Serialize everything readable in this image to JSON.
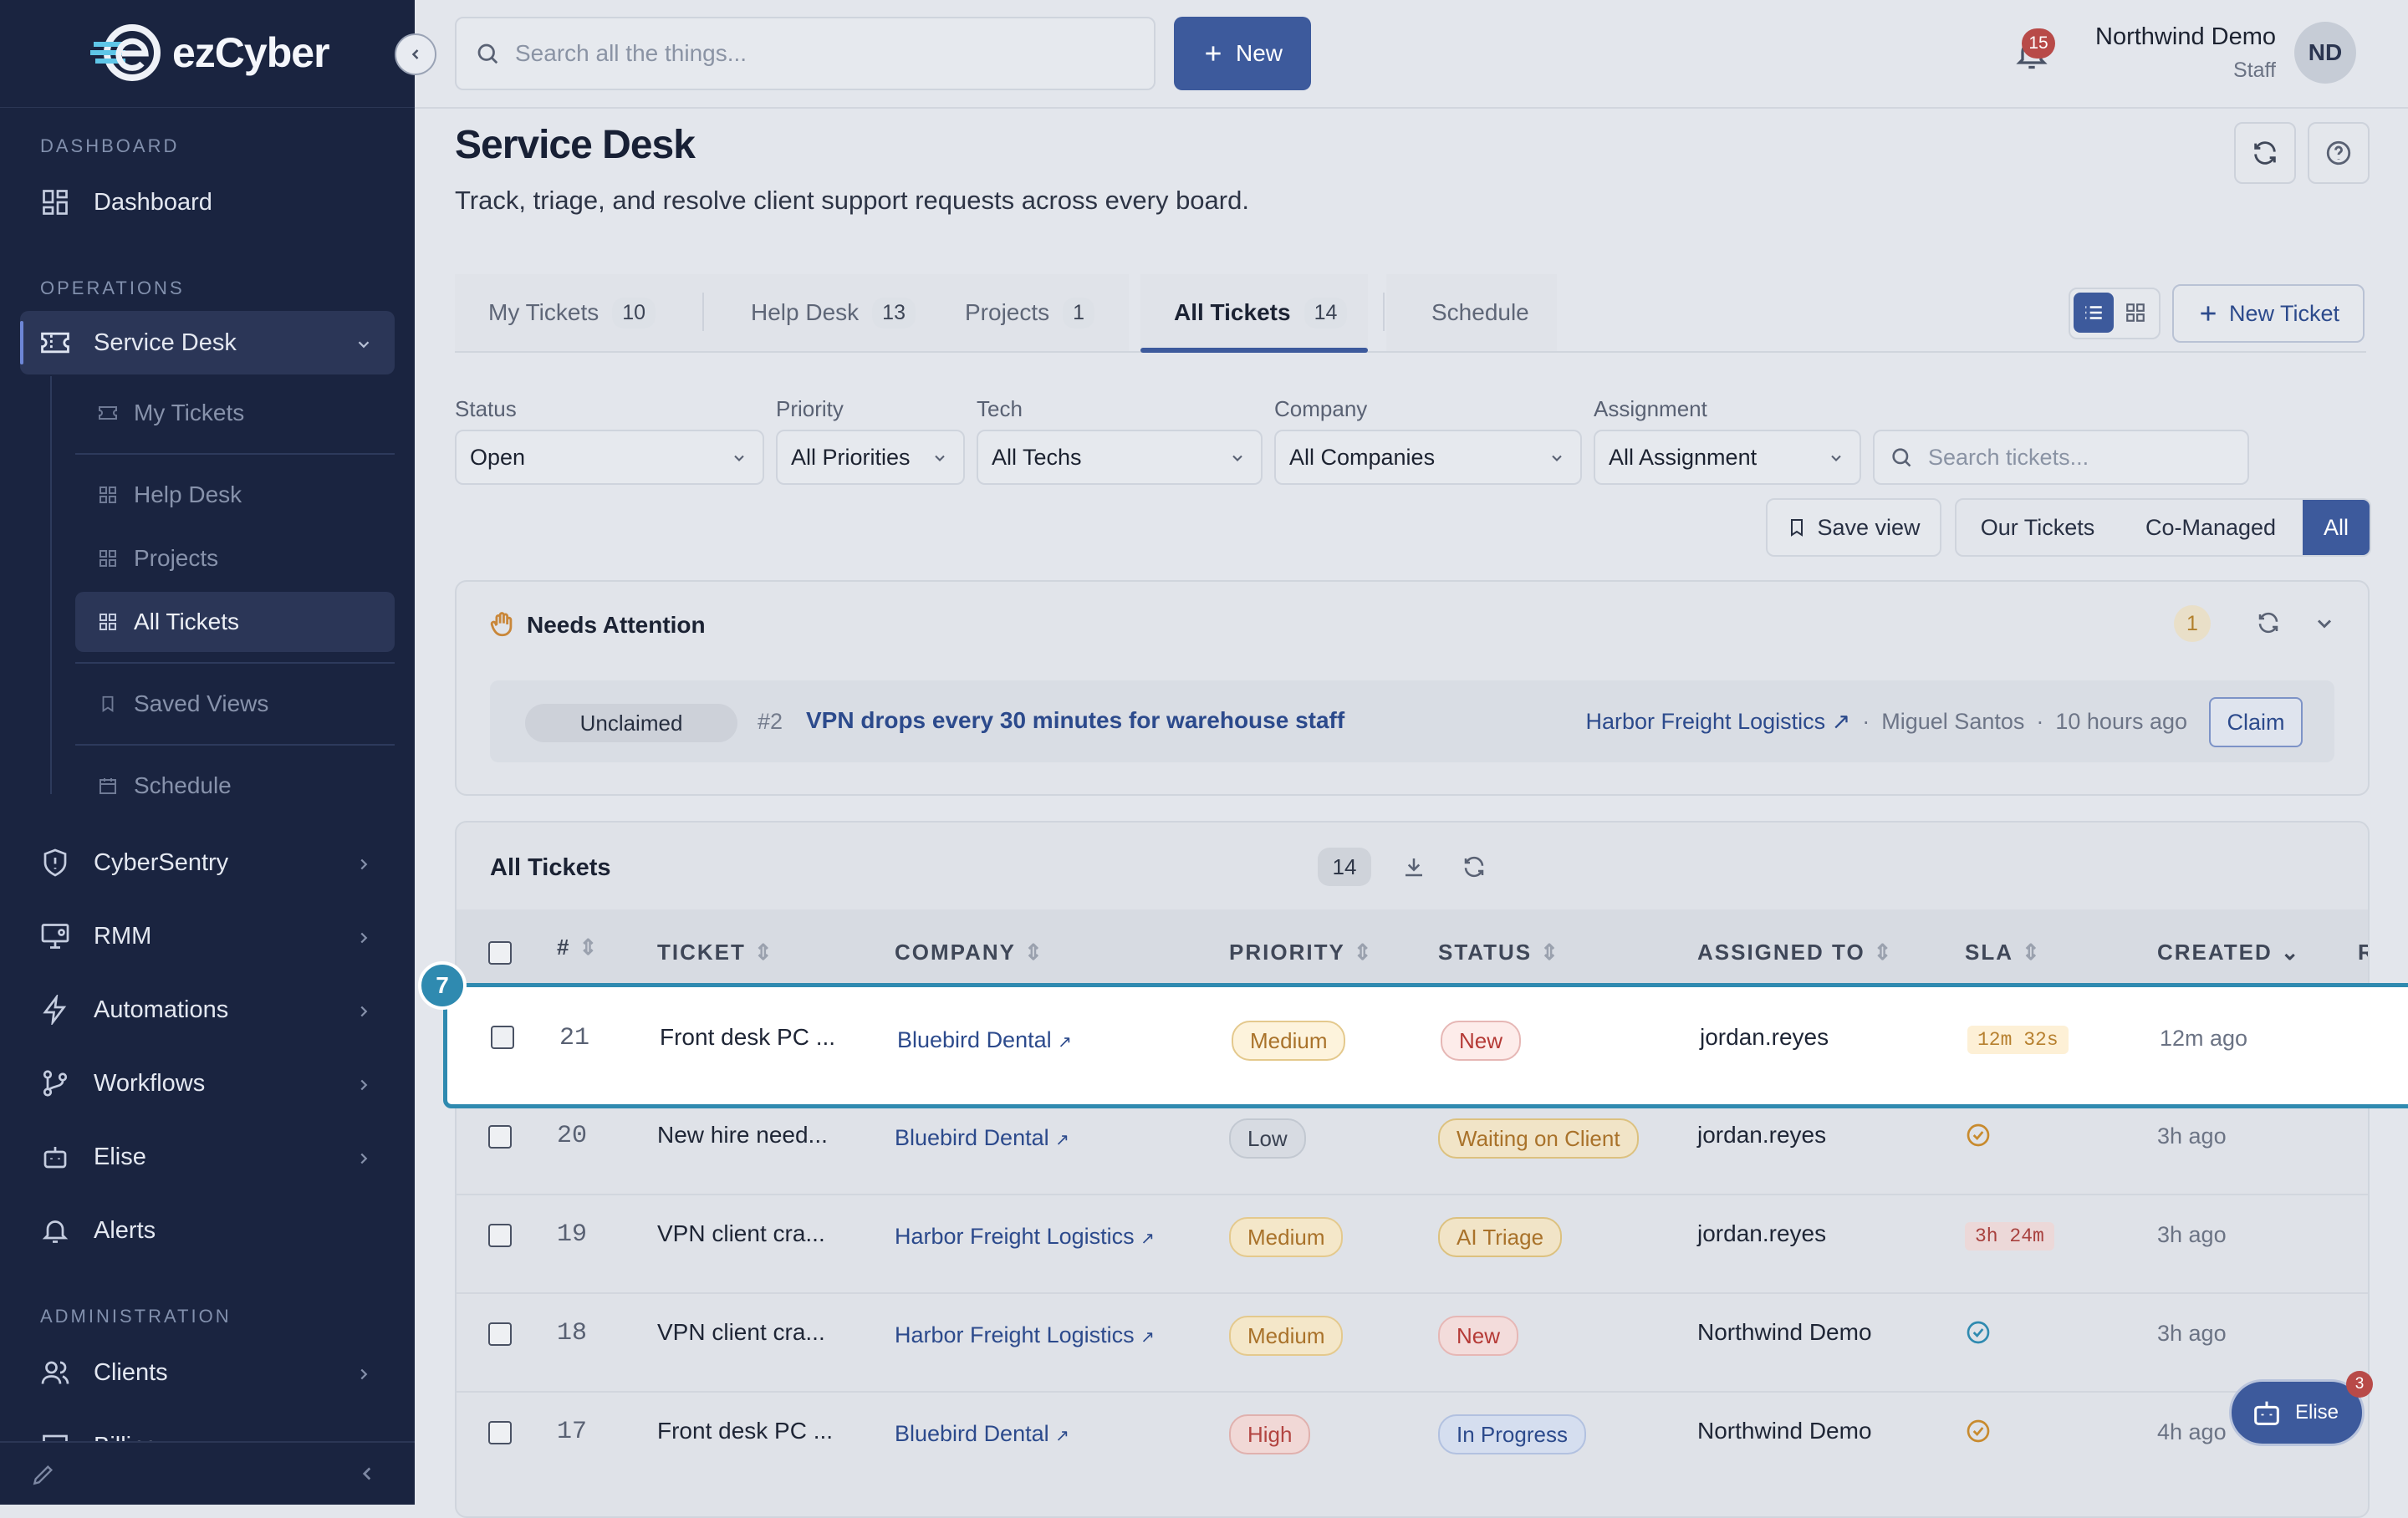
{
  "app": {
    "logo_text": "ezCyber"
  },
  "sidebar": {
    "sections": {
      "dashboard": "DASHBOARD",
      "operations": "OPERATIONS",
      "administration": "ADMINISTRATION"
    },
    "items": {
      "dashboard": "Dashboard",
      "service_desk": "Service Desk",
      "cybersentry": "CyberSentry",
      "rmm": "RMM",
      "automations": "Automations",
      "workflows": "Workflows",
      "elise": "Elise",
      "alerts": "Alerts",
      "clients": "Clients",
      "billing": "Billing"
    },
    "sub_items": {
      "my_tickets": "My Tickets",
      "help_desk": "Help Desk",
      "projects": "Projects",
      "all_tickets": "All Tickets",
      "saved_views": "Saved Views",
      "schedule": "Schedule"
    }
  },
  "topbar": {
    "search_placeholder": "Search all the things...",
    "new_label": "New",
    "notification_count": "15",
    "user_name": "Northwind Demo",
    "user_role": "Staff",
    "user_initials": "ND"
  },
  "page": {
    "title": "Service Desk",
    "subtitle": "Track, triage, and resolve client support requests across every board."
  },
  "tabs": [
    {
      "label": "My Tickets",
      "count": "10"
    },
    {
      "label": "Help Desk",
      "count": "13"
    },
    {
      "label": "Projects",
      "count": "1"
    },
    {
      "label": "All Tickets",
      "count": "14"
    },
    {
      "label": "Schedule",
      "count": ""
    }
  ],
  "new_ticket_label": "New Ticket",
  "filters": {
    "status": {
      "label": "Status",
      "value": "Open"
    },
    "priority": {
      "label": "Priority",
      "value": "All Priorities"
    },
    "tech": {
      "label": "Tech",
      "value": "All Techs"
    },
    "company": {
      "label": "Company",
      "value": "All Companies"
    },
    "assignment": {
      "label": "Assignment",
      "value": "All Assignment"
    },
    "search_placeholder": "Search tickets..."
  },
  "save_view_label": "Save view",
  "scope": {
    "ours": "Our Tickets",
    "co": "Co-Managed",
    "all": "All"
  },
  "needs_attention": {
    "title": "Needs Attention",
    "count": "1",
    "item": {
      "state": "Unclaimed",
      "number": "#2",
      "title": "VPN drops every 30 minutes for warehouse staff",
      "company": "Harbor Freight Logistics",
      "contact": "Miguel Santos",
      "age": "10 hours ago",
      "claim": "Claim"
    }
  },
  "table": {
    "title": "All Tickets",
    "count": "14",
    "columns": {
      "num": "#",
      "ticket": "TICKET",
      "company": "COMPANY",
      "priority": "PRIORITY",
      "status": "STATUS",
      "assigned": "ASSIGNED TO",
      "sla": "SLA",
      "created": "CREATED",
      "extra": "R"
    },
    "rows": [
      {
        "num": "21",
        "ticket": "Front desk PC ...",
        "company": "Bluebird Dental",
        "priority": "Medium",
        "status": "New",
        "assigned": "jordan.reyes",
        "sla": "12m 32s",
        "created": "12m ago"
      },
      {
        "num": "20",
        "ticket": "New hire need...",
        "company": "Bluebird Dental",
        "priority": "Low",
        "status": "Waiting on Client",
        "assigned": "jordan.reyes",
        "sla": "",
        "created": "3h ago"
      },
      {
        "num": "19",
        "ticket": "VPN client cra...",
        "company": "Harbor Freight Logistics",
        "priority": "Medium",
        "status": "AI Triage",
        "assigned": "jordan.reyes",
        "sla": "3h 24m",
        "created": "3h ago"
      },
      {
        "num": "18",
        "ticket": "VPN client cra...",
        "company": "Harbor Freight Logistics",
        "priority": "Medium",
        "status": "New",
        "assigned": "Northwind Demo",
        "sla": "",
        "created": "3h ago"
      },
      {
        "num": "17",
        "ticket": "Front desk PC ...",
        "company": "Bluebird Dental",
        "priority": "High",
        "status": "In Progress",
        "assigned": "Northwind Demo",
        "sla": "",
        "created": "4h ago"
      }
    ]
  },
  "highlight_badge": "7",
  "elise_widget": {
    "label": "Elise",
    "count": "3"
  },
  "colors": {
    "sidebar": "#1a2440",
    "accent": "#3d5a9c",
    "highlight": "#2f8ab0"
  }
}
